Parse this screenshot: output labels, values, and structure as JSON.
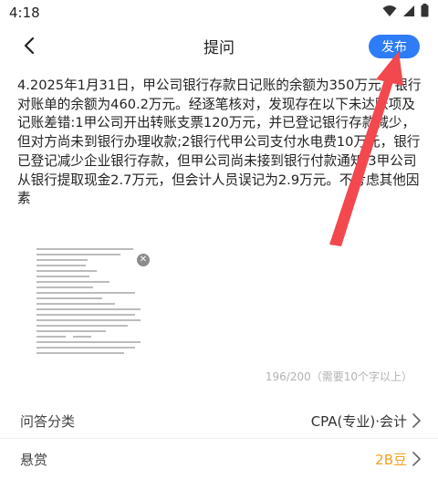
{
  "status_bar": {
    "time": "4:18",
    "icons": [
      "wifi-icon",
      "cellular-signal-icon",
      "battery-icon"
    ]
  },
  "header": {
    "title": "提问",
    "publish_label": "发布",
    "back_icon": "back-arrow-icon"
  },
  "question": {
    "text": "4.2025年1月31日，甲公司银行存款日记账的余额为350万元，银行对账单的余额为460.2万元。经逐笔核对，发现存在以下未达账项及记账差错:1甲公司开出转账支票120万元，并已登记银行存款减少，但对方尚未到银行办理收款;2银行代甲公司支付水电费10万元，银行已登记减少企业银行存款，但甲公司尚未接到银行付款通知;3甲公司从银行提取现金2.7万元，但会计人员误记为2.9万元。不考虑其他因素"
  },
  "attachment": {
    "remove_icon": "close-icon",
    "remove_glyph": "✕"
  },
  "char_count": "196/200（需要10个字以上）",
  "form": {
    "category_label": "问答分类",
    "category_value": "CPA(专业)·会计",
    "reward_label": "悬赏",
    "reward_value": "2B豆"
  },
  "colors": {
    "accent": "#2e7cf6",
    "reward": "#f4a21e",
    "annotation_arrow": "#f2484e"
  }
}
